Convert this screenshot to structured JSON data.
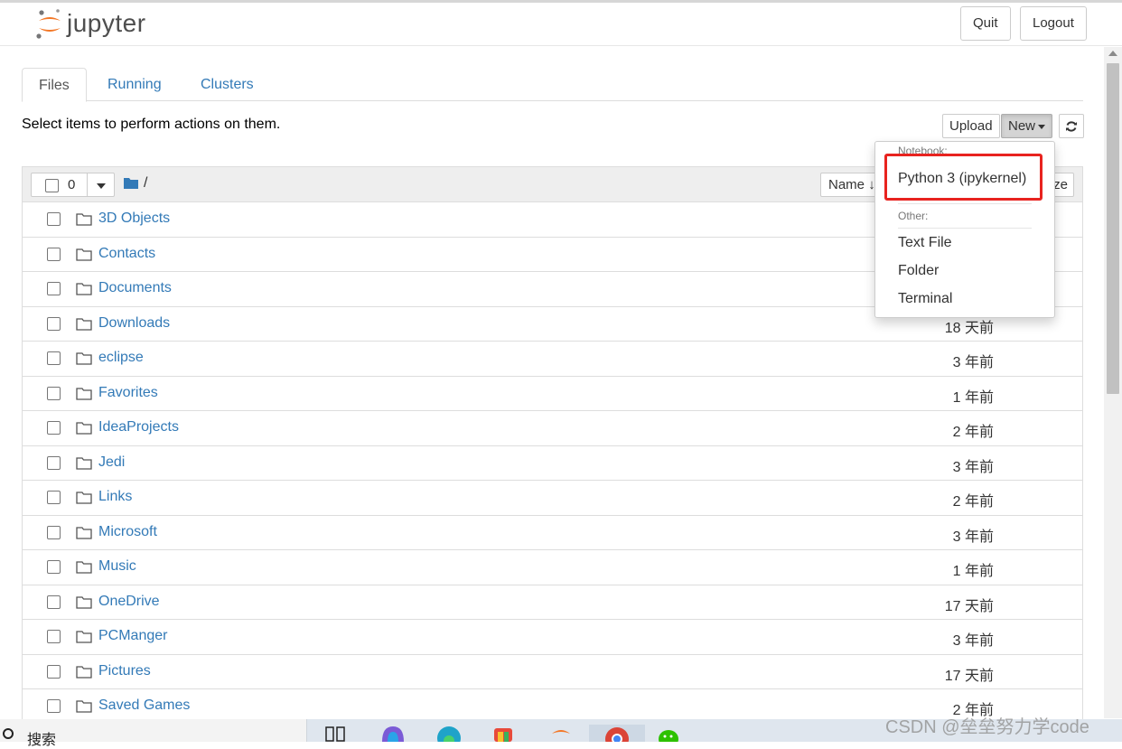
{
  "app": {
    "name": "jupyter"
  },
  "header": {
    "quit_label": "Quit",
    "logout_label": "Logout"
  },
  "tabs": [
    {
      "label": "Files",
      "active": true
    },
    {
      "label": "Running",
      "active": false
    },
    {
      "label": "Clusters",
      "active": false
    }
  ],
  "toolbar": {
    "instructions": "Select items to perform actions on them.",
    "upload_label": "Upload",
    "new_label": "New",
    "refresh_icon": "refresh-icon"
  },
  "list_header": {
    "selected_count": "0",
    "path": "/",
    "sort_name_label": "Name",
    "sort_size_label": "ze"
  },
  "new_menu": {
    "notebook_header": "Notebook:",
    "python_kernel": "Python 3 (ipykernel)",
    "other_header": "Other:",
    "text_file": "Text File",
    "folder": "Folder",
    "terminal": "Terminal"
  },
  "files": [
    {
      "name": "3D Objects",
      "modified": ""
    },
    {
      "name": "Contacts",
      "modified": ""
    },
    {
      "name": "Documents",
      "modified": ""
    },
    {
      "name": "Downloads",
      "modified": "18 天前"
    },
    {
      "name": "eclipse",
      "modified": "3 年前"
    },
    {
      "name": "Favorites",
      "modified": "1 年前"
    },
    {
      "name": "IdeaProjects",
      "modified": "2 年前"
    },
    {
      "name": "Jedi",
      "modified": "3 年前"
    },
    {
      "name": "Links",
      "modified": "2 年前"
    },
    {
      "name": "Microsoft",
      "modified": "3 年前"
    },
    {
      "name": "Music",
      "modified": "1 年前"
    },
    {
      "name": "OneDrive",
      "modified": "17 天前"
    },
    {
      "name": "PCManger",
      "modified": "3 年前"
    },
    {
      "name": "Pictures",
      "modified": "17 天前"
    },
    {
      "name": "Saved Games",
      "modified": "2 年前"
    }
  ],
  "taskbar": {
    "search_text": "搜索"
  },
  "watermark": "CSDN @垒垒努力学code",
  "colors": {
    "accent": "#337ab7",
    "logo_orange": "#f37726",
    "highlight": "#e8231f"
  }
}
